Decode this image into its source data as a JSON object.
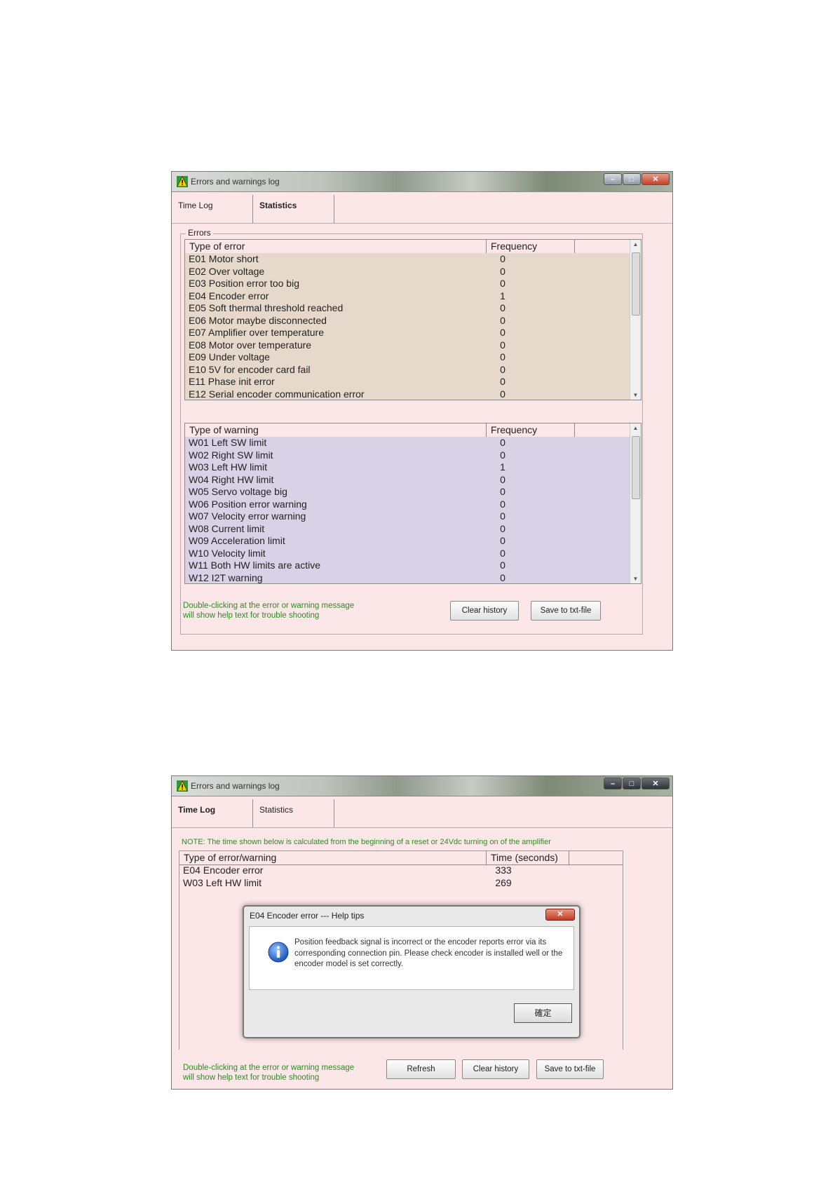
{
  "window1": {
    "title": "Errors and warnings log",
    "tabs": [
      {
        "label": "Time Log"
      },
      {
        "label": "Statistics"
      }
    ],
    "group_label": "Errors",
    "errors_header": {
      "type": "Type of error",
      "freq": "Frequency"
    },
    "errors": [
      {
        "name": "E01 Motor short",
        "freq": "0"
      },
      {
        "name": "E02 Over voltage",
        "freq": "0"
      },
      {
        "name": "E03 Position error too big",
        "freq": "0"
      },
      {
        "name": "E04 Encoder error",
        "freq": "1"
      },
      {
        "name": "E05 Soft thermal threshold reached",
        "freq": "0"
      },
      {
        "name": "E06 Motor maybe disconnected",
        "freq": "0"
      },
      {
        "name": "E07 Amplifier over temperature",
        "freq": "0"
      },
      {
        "name": "E08 Motor over temperature",
        "freq": "0"
      },
      {
        "name": "E09 Under voltage",
        "freq": "0"
      },
      {
        "name": "E10 5V for encoder card fail",
        "freq": "0"
      },
      {
        "name": "E11 Phase init error",
        "freq": "0"
      },
      {
        "name": "E12 Serial encoder communication error",
        "freq": "0"
      }
    ],
    "warnings_header": {
      "type": "Type of warning",
      "freq": "Frequency"
    },
    "warnings": [
      {
        "name": "W01 Left SW limit",
        "freq": "0"
      },
      {
        "name": "W02 Right SW limit",
        "freq": "0"
      },
      {
        "name": "W03 Left HW limit",
        "freq": "1"
      },
      {
        "name": "W04 Right HW limit",
        "freq": "0"
      },
      {
        "name": "W05 Servo voltage big",
        "freq": "0"
      },
      {
        "name": "W06 Position error warning",
        "freq": "0"
      },
      {
        "name": "W07 Velocity error warning",
        "freq": "0"
      },
      {
        "name": "W08 Current limit",
        "freq": "0"
      },
      {
        "name": "W09 Acceleration limit",
        "freq": "0"
      },
      {
        "name": "W10 Velocity limit",
        "freq": "0"
      },
      {
        "name": "W11 Both HW limits are active",
        "freq": "0"
      },
      {
        "name": "W12 I2T warning",
        "freq": "0"
      }
    ],
    "hint_line1": "Double-clicking at the error or warning message",
    "hint_line2": "will show help text for trouble shooting",
    "clear_label": "Clear history",
    "save_label": "Save to txt-file"
  },
  "window2": {
    "title": "Errors and warnings log",
    "tabs": [
      {
        "label": "Time Log"
      },
      {
        "label": "Statistics"
      }
    ],
    "note": "NOTE: The time shown below is calculated from the beginning of a reset or 24Vdc turning on of the amplifier",
    "header": {
      "type": "Type of error/warning",
      "time": "Time (seconds)"
    },
    "rows": [
      {
        "name": "E04 Encoder error",
        "time": "333"
      },
      {
        "name": "W03 Left HW limit",
        "time": "269"
      }
    ],
    "dialog": {
      "title": "E04 Encoder error --- Help tips",
      "message": "Position feedback signal is incorrect or the encoder reports error via its corresponding connection pin. Please check encoder is installed well or the encoder model is set correctly.",
      "ok_label": "確定"
    },
    "hint_line1": "Double-clicking at the error or warning message",
    "hint_line2": "will show help text for trouble shooting",
    "refresh_label": "Refresh",
    "clear_label": "Clear history",
    "save_label": "Save to txt-file"
  },
  "colors": {
    "errors_bg": "#e6d9cc",
    "warnings_bg": "#d9d2e6",
    "window_bg": "#fbe6e8",
    "hint": "#2e8b22"
  }
}
